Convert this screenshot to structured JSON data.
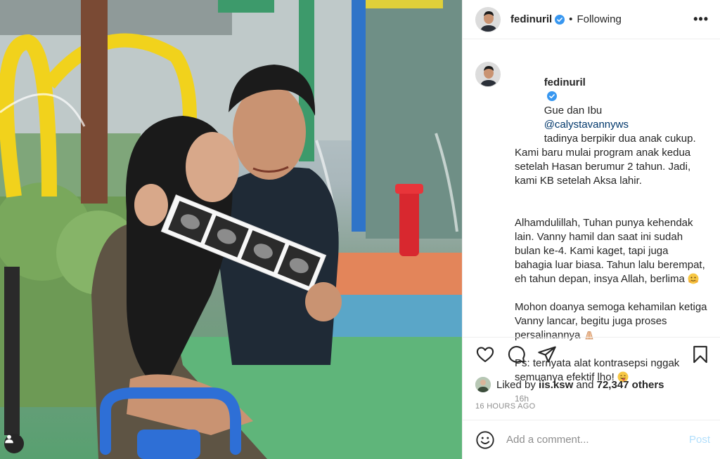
{
  "post": {
    "username": "fedinuril",
    "follow_status": "Following",
    "more_label": "•••",
    "separator": "•"
  },
  "caption": {
    "username": "fedinuril",
    "intro": "Gue dan Ibu",
    "mention": "@calystavannyws",
    "line1_rest": "tadinya berpikir dua anak cukup. Kami baru mulai program anak kedua setelah Hasan berumur 2 tahun. Jadi, kami KB setelah Aksa lahir.",
    "paragraph2": "Alhamdulillah, Tuhan punya kehendak lain. Vanny hamil dan saat ini sudah bulan ke-4. Kami kaget, tapi juga bahagia luar biasa. Tahun lalu berempat, eh tahun depan, insya Allah, berlima",
    "paragraph3": "Mohon doanya semoga kehamilan ketiga Vanny lancar, begitu juga proses persalinannya",
    "paragraph4": "Ps: ternyata alat kontrasepsi nggak semuanya efektif lho!",
    "time_ago": "16h"
  },
  "likes": {
    "prefix": "Liked by",
    "liker": "iis.ksw",
    "conj": "and",
    "others": "72,347 others"
  },
  "timestamp": "16 HOURS AGO",
  "comment": {
    "placeholder": "Add a comment...",
    "post_label": "Post"
  },
  "colors": {
    "verified": "#3897f0",
    "link": "#00376b",
    "post_disabled": "#b2dffc",
    "muted": "#8e8e8e"
  },
  "icons": [
    "heart-icon",
    "comment-icon",
    "share-icon",
    "bookmark-icon",
    "smile-icon",
    "verified-icon",
    "user-tag-icon"
  ]
}
